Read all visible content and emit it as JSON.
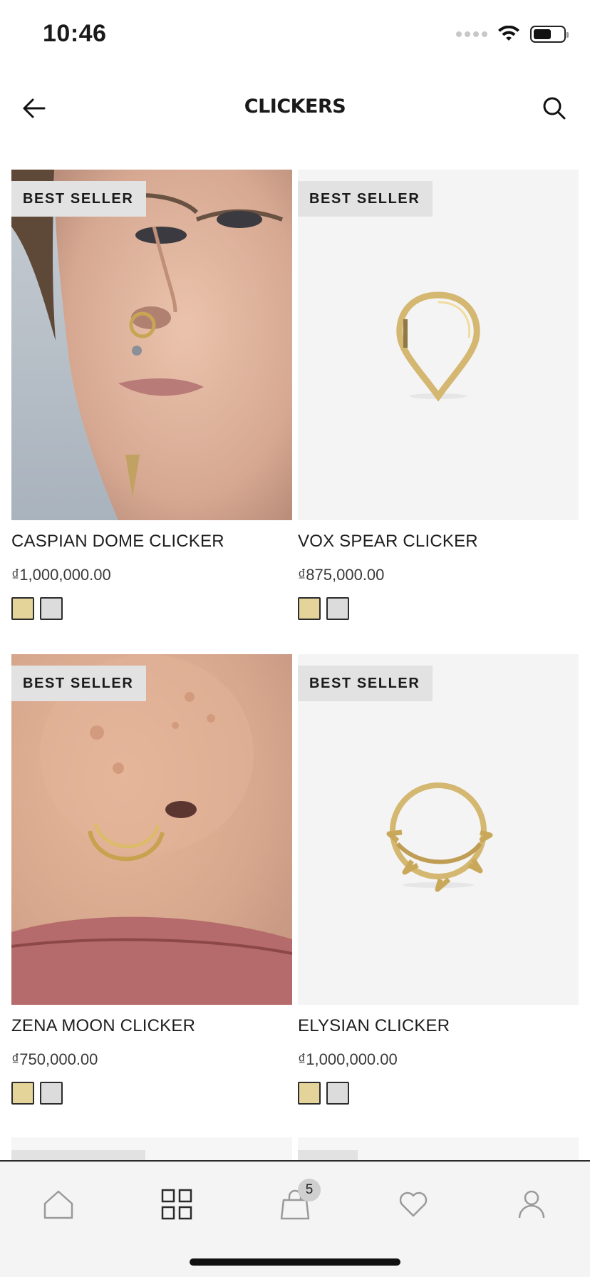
{
  "status_bar": {
    "time": "10:46"
  },
  "header": {
    "title": "CLICKERS"
  },
  "products": [
    {
      "badge": "BEST SELLER",
      "name": "CASPIAN DOME CLICKER",
      "price": "₫1,000,000.00",
      "swatches": [
        "#e5d49a",
        "#dcdcdc"
      ],
      "image": "model-face-nose-clicker"
    },
    {
      "badge": "BEST SELLER",
      "name": "VOX SPEAR CLICKER",
      "price": "₫875,000.00",
      "swatches": [
        "#e5d49a",
        "#dcdcdc"
      ],
      "image": "gold-spear-clicker"
    },
    {
      "badge": "BEST SELLER",
      "name": "ZENA MOON CLICKER",
      "price": "₫750,000.00",
      "swatches": [
        "#e5d49a",
        "#dcdcdc"
      ],
      "image": "nose-closeup-moon-clicker"
    },
    {
      "badge": "BEST SELLER",
      "name": "ELYSIAN CLICKER",
      "price": "₫1,000,000.00",
      "swatches": [
        "#e5d49a",
        "#dcdcdc"
      ],
      "image": "gold-thorn-clicker"
    }
  ],
  "tab_bar": {
    "items": [
      {
        "name": "home-icon"
      },
      {
        "name": "grid-icon",
        "active": true
      },
      {
        "name": "bag-icon",
        "badge": "5"
      },
      {
        "name": "heart-icon"
      },
      {
        "name": "user-icon"
      }
    ]
  },
  "colors": {
    "gold_swatch": "#e5d49a",
    "silver_swatch": "#dcdcdc",
    "accent": "#1a1a1a"
  }
}
